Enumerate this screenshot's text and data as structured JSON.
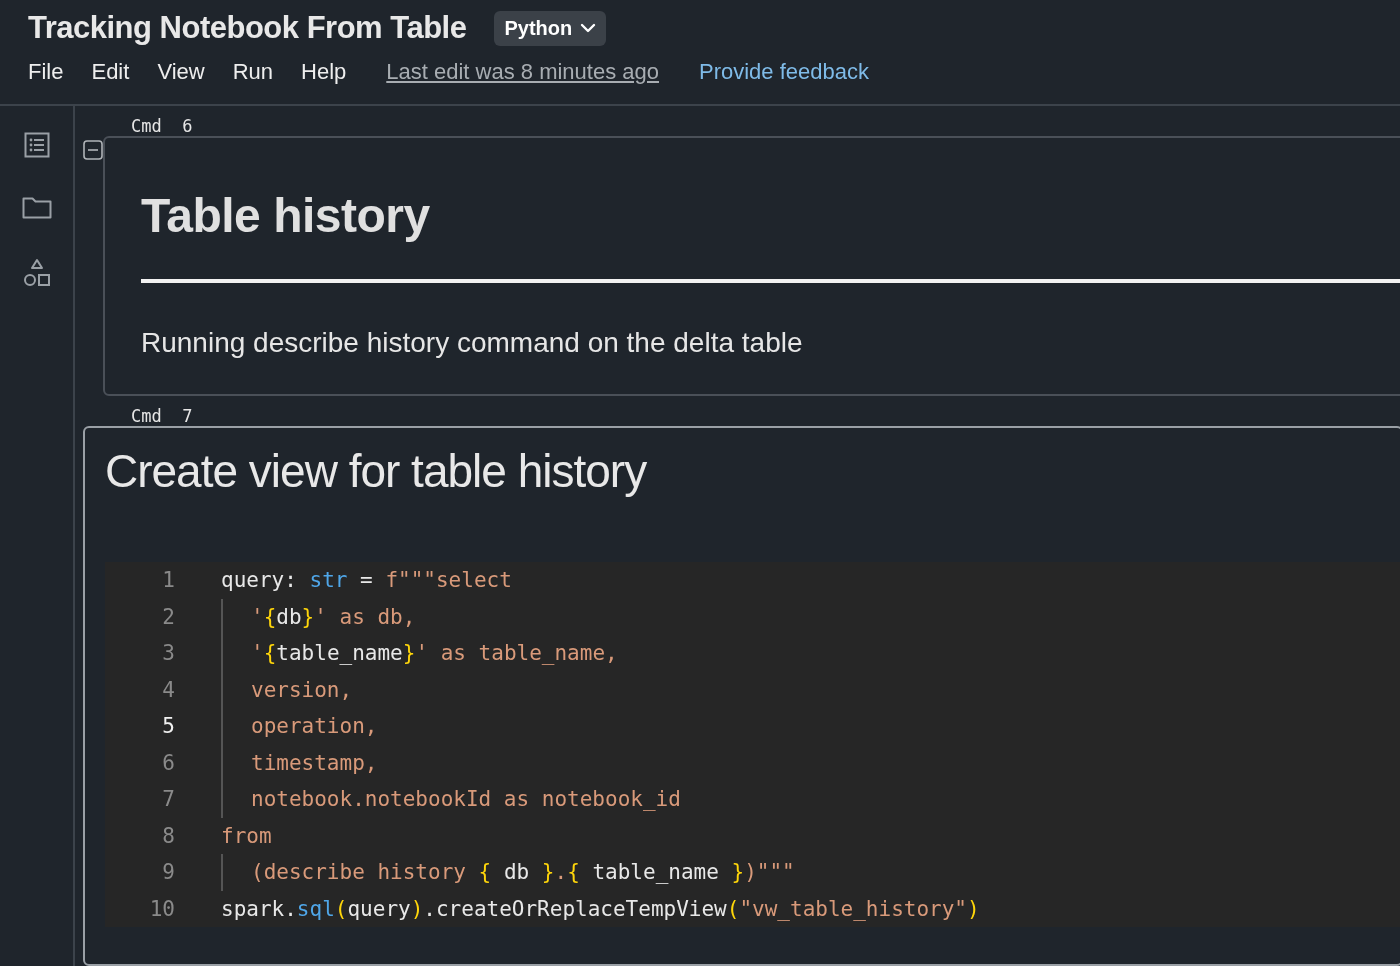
{
  "notebook": {
    "title": "Tracking Notebook From Table",
    "language": "Python"
  },
  "menu": [
    "File",
    "Edit",
    "View",
    "Run",
    "Help"
  ],
  "last_edit": "Last edit was 8 minutes ago",
  "feedback_link": "Provide feedback",
  "cells": [
    {
      "kind": "markdown",
      "label": "Cmd  6",
      "collapsed": false,
      "heading": "Table history",
      "text": "Running describe history command on the delta table"
    },
    {
      "kind": "code",
      "label": "Cmd  7",
      "title": "Create view for table history",
      "lines": [
        {
          "number": "1",
          "selected": false,
          "indented": false,
          "tokens": [
            {
              "text": "query: ",
              "kind": "plain"
            },
            {
              "text": "str",
              "kind": "type"
            },
            {
              "text": " = ",
              "kind": "plain"
            },
            {
              "text": "f\"\"\"select",
              "kind": "string"
            }
          ]
        },
        {
          "number": "2",
          "selected": false,
          "indented": true,
          "tokens": [
            {
              "text": "'",
              "kind": "string"
            },
            {
              "text": "{",
              "kind": "brace"
            },
            {
              "text": "db",
              "kind": "plain"
            },
            {
              "text": "}",
              "kind": "brace"
            },
            {
              "text": "' as db,",
              "kind": "string"
            }
          ]
        },
        {
          "number": "3",
          "selected": false,
          "indented": true,
          "tokens": [
            {
              "text": "'",
              "kind": "string"
            },
            {
              "text": "{",
              "kind": "brace"
            },
            {
              "text": "table_name",
              "kind": "plain"
            },
            {
              "text": "}",
              "kind": "brace"
            },
            {
              "text": "' as table_name,",
              "kind": "string"
            }
          ]
        },
        {
          "number": "4",
          "selected": false,
          "indented": true,
          "tokens": [
            {
              "text": "version,",
              "kind": "string"
            }
          ]
        },
        {
          "number": "5",
          "selected": true,
          "indented": true,
          "tokens": [
            {
              "text": "operation,",
              "kind": "string"
            }
          ]
        },
        {
          "number": "6",
          "selected": false,
          "indented": true,
          "tokens": [
            {
              "text": "timestamp,",
              "kind": "string"
            }
          ]
        },
        {
          "number": "7",
          "selected": false,
          "indented": true,
          "tokens": [
            {
              "text": "notebook.notebookId as notebook_id",
              "kind": "string"
            }
          ]
        },
        {
          "number": "8",
          "selected": false,
          "indented": false,
          "tokens": [
            {
              "text": "from",
              "kind": "string"
            }
          ]
        },
        {
          "number": "9",
          "selected": false,
          "indented": true,
          "tokens": [
            {
              "text": "(describe history ",
              "kind": "string"
            },
            {
              "text": "{",
              "kind": "brace"
            },
            {
              "text": " db ",
              "kind": "plain"
            },
            {
              "text": "}",
              "kind": "brace"
            },
            {
              "text": ".",
              "kind": "string"
            },
            {
              "text": "{",
              "kind": "brace"
            },
            {
              "text": " table_name ",
              "kind": "plain"
            },
            {
              "text": "}",
              "kind": "brace"
            },
            {
              "text": ")\"\"\"",
              "kind": "string"
            }
          ]
        },
        {
          "number": "10",
          "selected": false,
          "indented": false,
          "tokens": [
            {
              "text": "spark.",
              "kind": "plain"
            },
            {
              "text": "sql",
              "kind": "type"
            },
            {
              "text": "(",
              "kind": "brace"
            },
            {
              "text": "query",
              "kind": "plain"
            },
            {
              "text": ")",
              "kind": "brace"
            },
            {
              "text": ".createOrReplaceTempView",
              "kind": "plain"
            },
            {
              "text": "(",
              "kind": "brace"
            },
            {
              "text": "\"vw_table_history\"",
              "kind": "string"
            },
            {
              "text": ")",
              "kind": "brace"
            }
          ]
        }
      ]
    }
  ]
}
